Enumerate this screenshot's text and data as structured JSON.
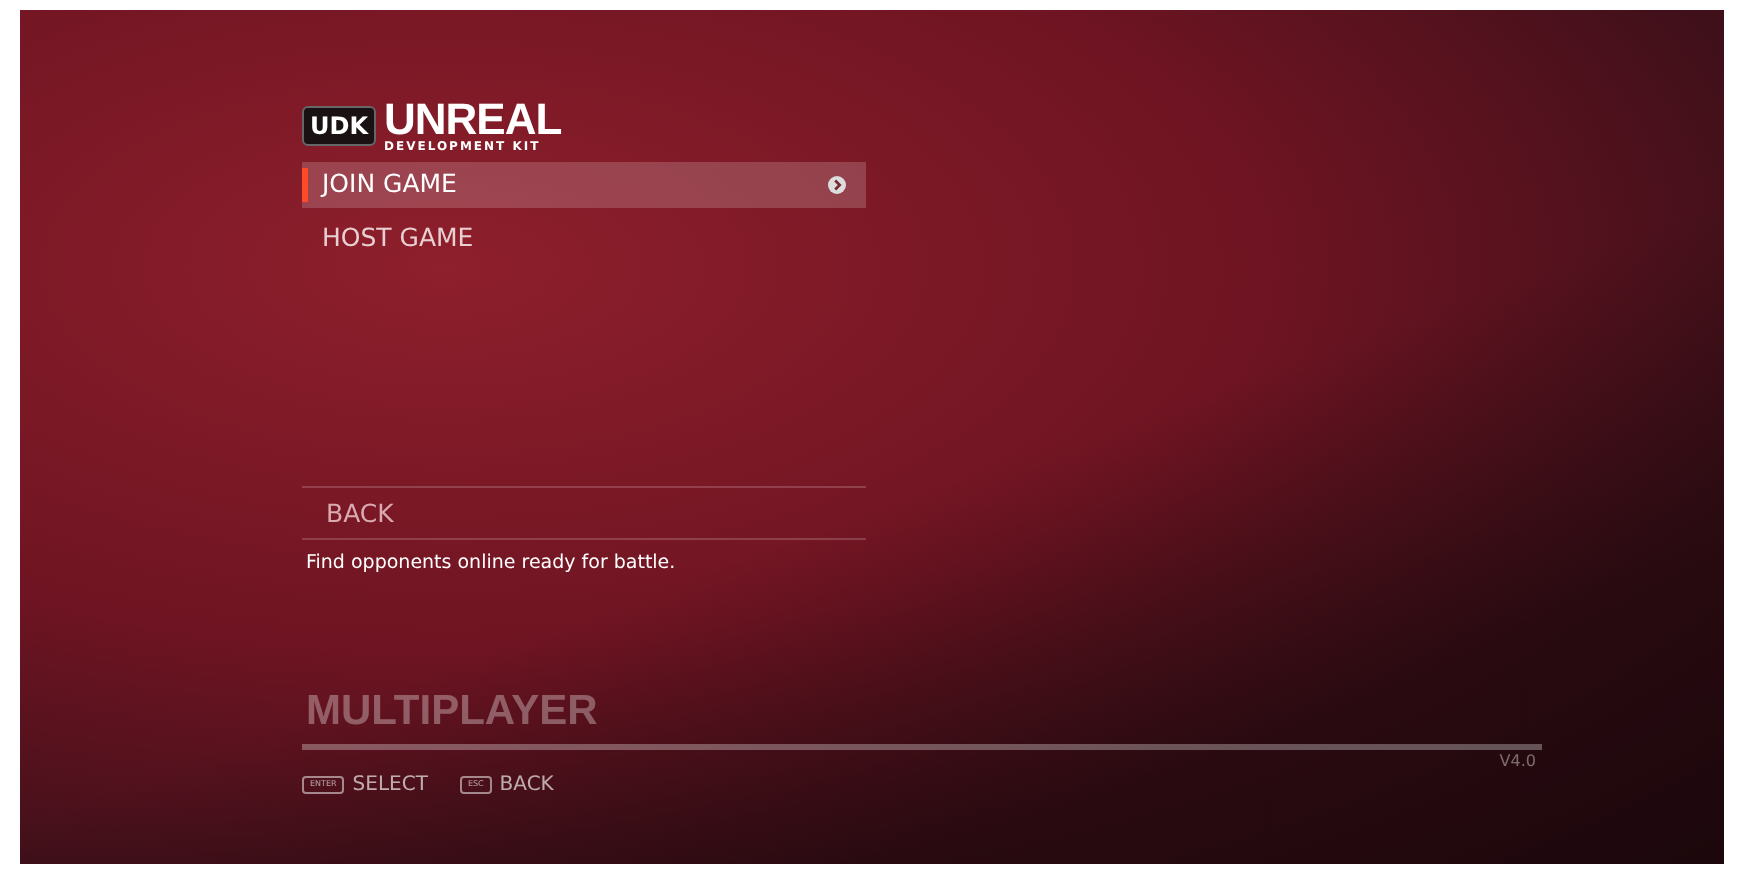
{
  "logo": {
    "badge": "UDK",
    "title": "UNREAL",
    "subtitle": "DEVELOPMENT KIT"
  },
  "menu": [
    {
      "label": "JOIN GAME",
      "selected": true
    },
    {
      "label": "HOST GAME",
      "selected": false
    }
  ],
  "back": {
    "label": "BACK"
  },
  "description": "Find opponents online ready for battle.",
  "screen_title": "MULTIPLAYER",
  "version": "V4.0",
  "hints": [
    {
      "key": "ENTER",
      "label": "SELECT"
    },
    {
      "key": "ESC",
      "label": "BACK"
    }
  ]
}
